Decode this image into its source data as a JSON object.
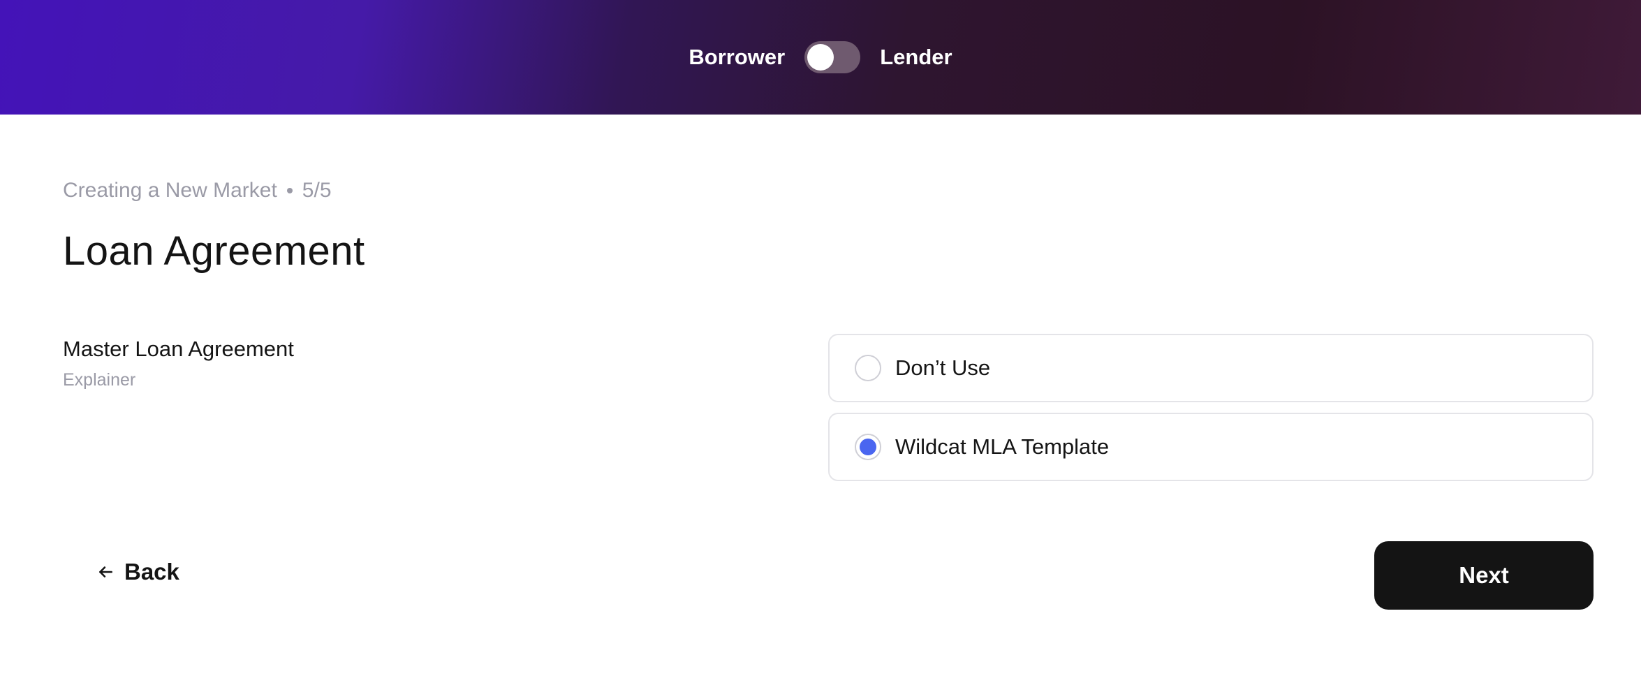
{
  "header": {
    "left_label": "Borrower",
    "right_label": "Lender",
    "toggle_state": "off"
  },
  "breadcrumb": {
    "flow": "Creating a New Market",
    "step": "5/5"
  },
  "page": {
    "title": "Loan Agreement"
  },
  "field": {
    "label": "Master Loan Agreement",
    "hint": "Explainer"
  },
  "options": [
    {
      "label": "Don’t Use",
      "selected": false
    },
    {
      "label": "Wildcat MLA Template",
      "selected": true
    }
  ],
  "actions": {
    "back_label": "Back",
    "back_icon": "arrow-left-icon",
    "next_label": "Next"
  },
  "colors": {
    "accent": "#4a66f0",
    "primary_button": "#141414",
    "muted_text": "#9a9aa6"
  }
}
